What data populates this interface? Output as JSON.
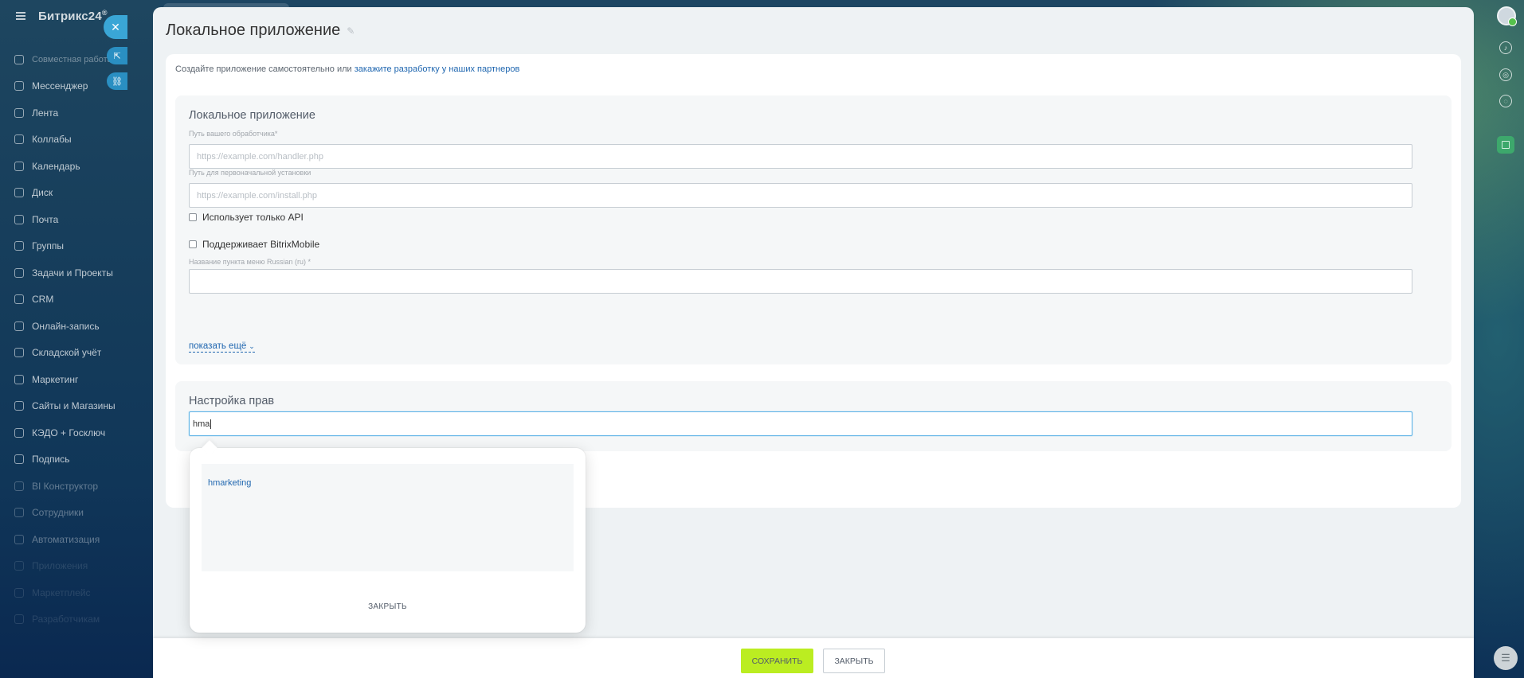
{
  "app": {
    "name": "Битрикс24",
    "mark": "®"
  },
  "sidebar": {
    "items": [
      {
        "label": "Совместная работа",
        "state": "first"
      },
      {
        "label": "Мессенджер",
        "state": "normal"
      },
      {
        "label": "Лента",
        "state": "normal"
      },
      {
        "label": "Коллабы",
        "state": "normal"
      },
      {
        "label": "Календарь",
        "state": "normal"
      },
      {
        "label": "Диск",
        "state": "normal"
      },
      {
        "label": "Почта",
        "state": "normal"
      },
      {
        "label": "Группы",
        "state": "normal"
      },
      {
        "label": "Задачи и Проекты",
        "state": "normal"
      },
      {
        "label": "CRM",
        "state": "normal"
      },
      {
        "label": "Онлайн-запись",
        "state": "normal"
      },
      {
        "label": "Складской учёт",
        "state": "normal"
      },
      {
        "label": "Маркетинг",
        "state": "normal"
      },
      {
        "label": "Сайты и Магазины",
        "state": "normal"
      },
      {
        "label": "КЭДО + Госключ",
        "state": "normal"
      },
      {
        "label": "Подпись",
        "state": "normal"
      },
      {
        "label": "BI Конструктор",
        "state": "dim"
      },
      {
        "label": "Сотрудники",
        "state": "dim"
      },
      {
        "label": "Автоматизация",
        "state": "dim"
      },
      {
        "label": "Приложения",
        "state": "faint"
      },
      {
        "label": "Маркетплейс",
        "state": "faint"
      },
      {
        "label": "Разработчикам",
        "state": "faint"
      }
    ]
  },
  "slider": {
    "title": "Локальное приложение",
    "intro_text": "Создайте приложение самостоятельно или ",
    "intro_link": "закажите разработку у наших партнеров",
    "section_app": {
      "title": "Локальное приложение",
      "handler_label": "Путь вашего обработчика*",
      "handler_placeholder": "https://example.com/handler.php",
      "install_label": "Путь для первоначальной установки",
      "install_placeholder": "https://example.com/install.php",
      "api_only_label": "Использует только API",
      "mobile_label": "Поддерживает BitrixMobile",
      "menu_name_label": "Название пункта меню Russian (ru) *",
      "menu_name_value": "",
      "show_more": "показать ещё"
    },
    "section_rights": {
      "title": "Настройка прав",
      "search_value": "hma"
    },
    "popup": {
      "result": "hmarketing",
      "close_label": "ЗАКРЫТЬ"
    },
    "footer": {
      "save_label": "СОХРАНИТЬ",
      "close_label": "ЗАКРЫТЬ"
    }
  },
  "colors": {
    "accent_link": "#2067b0",
    "save_button": "#bbed21",
    "close_side": "#3aa6d6"
  }
}
